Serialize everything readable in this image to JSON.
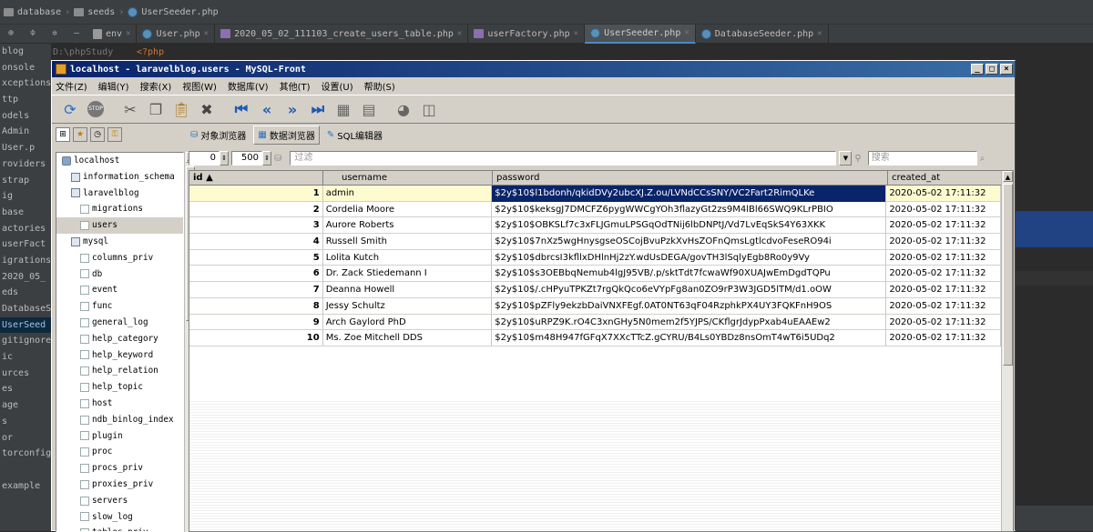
{
  "ide": {
    "breadcrumb": [
      "database",
      "seeds",
      "UserSeeder.php"
    ],
    "tabs": [
      {
        "label": "env"
      },
      {
        "label": "User.php"
      },
      {
        "label": "2020_05_02_111103_create_users_table.php"
      },
      {
        "label": "userFactory.php"
      },
      {
        "label": "UserSeeder.php",
        "active": true
      },
      {
        "label": "DatabaseSeeder.php"
      }
    ],
    "project_label": "blog",
    "project_path": "D:\\phpStudy",
    "code_line": "<?php",
    "project_items": [
      "onsole",
      "xceptions",
      "ttp",
      "odels",
      "Admin",
      "User.p",
      "roviders",
      "strap",
      "ig",
      "base",
      "actories",
      "userFact",
      "igrations",
      "2020_05_",
      "eds",
      "DatabaseS",
      "UserSeed",
      "gitignore",
      "ic",
      "urces",
      "es",
      "age",
      "s",
      "or",
      "torconfig",
      "",
      "example"
    ]
  },
  "window": {
    "title": "localhost - laravelblog.users - MySQL-Front",
    "buttons": {
      "minimize": "_",
      "maximize": "□",
      "close": "×"
    }
  },
  "menu": [
    "文件(Z)",
    "编辑(Y)",
    "搜索(X)",
    "视图(W)",
    "数据库(V)",
    "其他(T)",
    "设置(U)",
    "帮助(S)"
  ],
  "view_tabs": [
    "对象浏览器",
    "数据浏览器",
    "SQL编辑器"
  ],
  "tree": {
    "items": [
      {
        "label": "localhost",
        "level": 0,
        "icon": "host"
      },
      {
        "label": "information_schema",
        "level": 1,
        "icon": "db"
      },
      {
        "label": "laravelblog",
        "level": 1,
        "icon": "db"
      },
      {
        "label": "migrations",
        "level": 2,
        "icon": "table"
      },
      {
        "label": "users",
        "level": 2,
        "icon": "table",
        "selected": true
      },
      {
        "label": "mysql",
        "level": 1,
        "icon": "db"
      },
      {
        "label": "columns_priv",
        "level": 2,
        "icon": "table"
      },
      {
        "label": "db",
        "level": 2,
        "icon": "table"
      },
      {
        "label": "event",
        "level": 2,
        "icon": "table"
      },
      {
        "label": "func",
        "level": 2,
        "icon": "table"
      },
      {
        "label": "general_log",
        "level": 2,
        "icon": "table"
      },
      {
        "label": "help_category",
        "level": 2,
        "icon": "table"
      },
      {
        "label": "help_keyword",
        "level": 2,
        "icon": "table"
      },
      {
        "label": "help_relation",
        "level": 2,
        "icon": "table"
      },
      {
        "label": "help_topic",
        "level": 2,
        "icon": "table"
      },
      {
        "label": "host",
        "level": 2,
        "icon": "table"
      },
      {
        "label": "ndb_binlog_index",
        "level": 2,
        "icon": "table"
      },
      {
        "label": "plugin",
        "level": 2,
        "icon": "table"
      },
      {
        "label": "proc",
        "level": 2,
        "icon": "table"
      },
      {
        "label": "procs_priv",
        "level": 2,
        "icon": "table"
      },
      {
        "label": "proxies_priv",
        "level": 2,
        "icon": "table"
      },
      {
        "label": "servers",
        "level": 2,
        "icon": "table"
      },
      {
        "label": "slow_log",
        "level": 2,
        "icon": "table"
      },
      {
        "label": "tables_priv",
        "level": 2,
        "icon": "table"
      }
    ]
  },
  "filter": {
    "offset": "0",
    "limit": "500",
    "filter_placeholder": "过滤",
    "search_placeholder": "搜索"
  },
  "grid": {
    "columns": [
      "id ▲",
      "username",
      "password",
      "created_at"
    ],
    "rows": [
      {
        "id": "1",
        "username": "admin",
        "password": "$2y$10$l1bdonh/qkidDVy2ubcXJ.Z.ou/LVNdCCsSNY/VC2Fart2RimQLKe",
        "created_at": "2020-05-02 17:11:32"
      },
      {
        "id": "2",
        "username": "Cordelia Moore",
        "password": "$2y$10$keksgJ7DMCFZ6pygWWCgYOh3flazyGt2zs9M4lBl66SWQ9KLrPBIO",
        "created_at": "2020-05-02 17:11:32"
      },
      {
        "id": "3",
        "username": "Aurore Roberts",
        "password": "$2y$10$OBKSLf7c3xFLJGmuLPSGqOdTNij6lbDNPtJ/Vd7LvEqSkS4Y63XKK",
        "created_at": "2020-05-02 17:11:32"
      },
      {
        "id": "4",
        "username": "Russell Smith",
        "password": "$2y$10$7nXz5wgHnysgseOSCojBvuPzkXvHsZOFnQmsLgtlcdvoFeseRO94i",
        "created_at": "2020-05-02 17:11:32"
      },
      {
        "id": "5",
        "username": "Lolita Kutch",
        "password": "$2y$10$dbrcsI3kfllxDHlnHj2zY.wdUsDEGA/govTH3lSqlyEgb8Ro0y9Vy",
        "created_at": "2020-05-02 17:11:32"
      },
      {
        "id": "6",
        "username": "Dr. Zack Stiedemann I",
        "password": "$2y$10$s3OEBbqNemub4lgJ95VB/.p/sktTdt7fcwaWf90XUAJwEmDgdTQPu",
        "created_at": "2020-05-02 17:11:32"
      },
      {
        "id": "7",
        "username": "Deanna Howell",
        "password": "$2y$10$/.cHPyuTPKZt7rgQkQco6eVYpFg8an0ZO9rP3W3JGD5lTM/d1.oOW",
        "created_at": "2020-05-02 17:11:32"
      },
      {
        "id": "8",
        "username": "Jessy Schultz",
        "password": "$2y$10$pZFly9ekzbDaiVNXFEgf.0AT0NT63qF04RzphkPX4UY3FQKFnH9OS",
        "created_at": "2020-05-02 17:11:32"
      },
      {
        "id": "9",
        "username": "Arch Gaylord PhD",
        "password": "$2y$10$uRPZ9K.rO4C3xnGHy5N0mem2f5YJPS/CKflgrJdypPxab4uEAAEw2",
        "created_at": "2020-05-02 17:11:32"
      },
      {
        "id": "10",
        "username": "Ms. Zoe Mitchell DDS",
        "password": "$2y$10$m48H947fGFqX7XXcTTcZ.gCYRU/B4Ls0YBDz8nsOmT4wT6i5UDq2",
        "created_at": "2020-05-02 17:11:32"
      }
    ],
    "extra_col_value": "2"
  }
}
